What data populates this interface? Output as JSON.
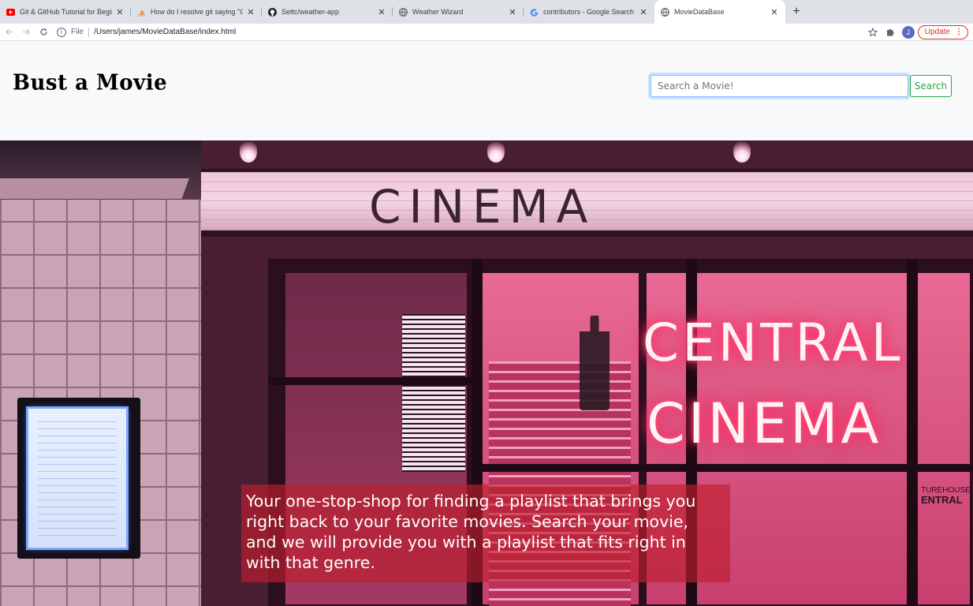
{
  "browser": {
    "tabs": [
      {
        "title": "Git & GitHub Tutorial for Beginn",
        "icon": "youtube-icon",
        "active": false
      },
      {
        "title": "How do I resolve git saying \"Co",
        "icon": "stackoverflow-icon",
        "active": false
      },
      {
        "title": "Settc/weather-app",
        "icon": "github-icon",
        "active": false
      },
      {
        "title": "Weather Wizard",
        "icon": "globe-icon",
        "active": false
      },
      {
        "title": "contributors - Google Search",
        "icon": "google-icon",
        "active": false
      },
      {
        "title": "MovieDataBase",
        "icon": "globe-icon",
        "active": true
      }
    ],
    "new_tab_symbol": "+",
    "close_symbol": "✕",
    "address": {
      "scheme": "File",
      "path": "/Users/james/MovieDataBase/index.html"
    },
    "profile_initial": "J",
    "update_label": "Update"
  },
  "page": {
    "brand": "Bust a Movie",
    "search": {
      "placeholder": "Search a Movie!",
      "value": "",
      "button_label": "Search"
    },
    "hero": {
      "sign_text": "CINEMA",
      "neon_line1": "CENTRAL",
      "neon_line2": "CINEMA",
      "storefront_small": "TUREHOUSE",
      "storefront_big": "ENTRAL",
      "tagline": "Your one-stop-shop for finding a playlist that brings you right back to your favorite movies. Search your movie, and we will provide you with a playlist that fits right in with that genre."
    }
  },
  "colors": {
    "search_button": "#28a745",
    "tagline_bg": "#be1e2d",
    "update_accent": "#d93025"
  }
}
